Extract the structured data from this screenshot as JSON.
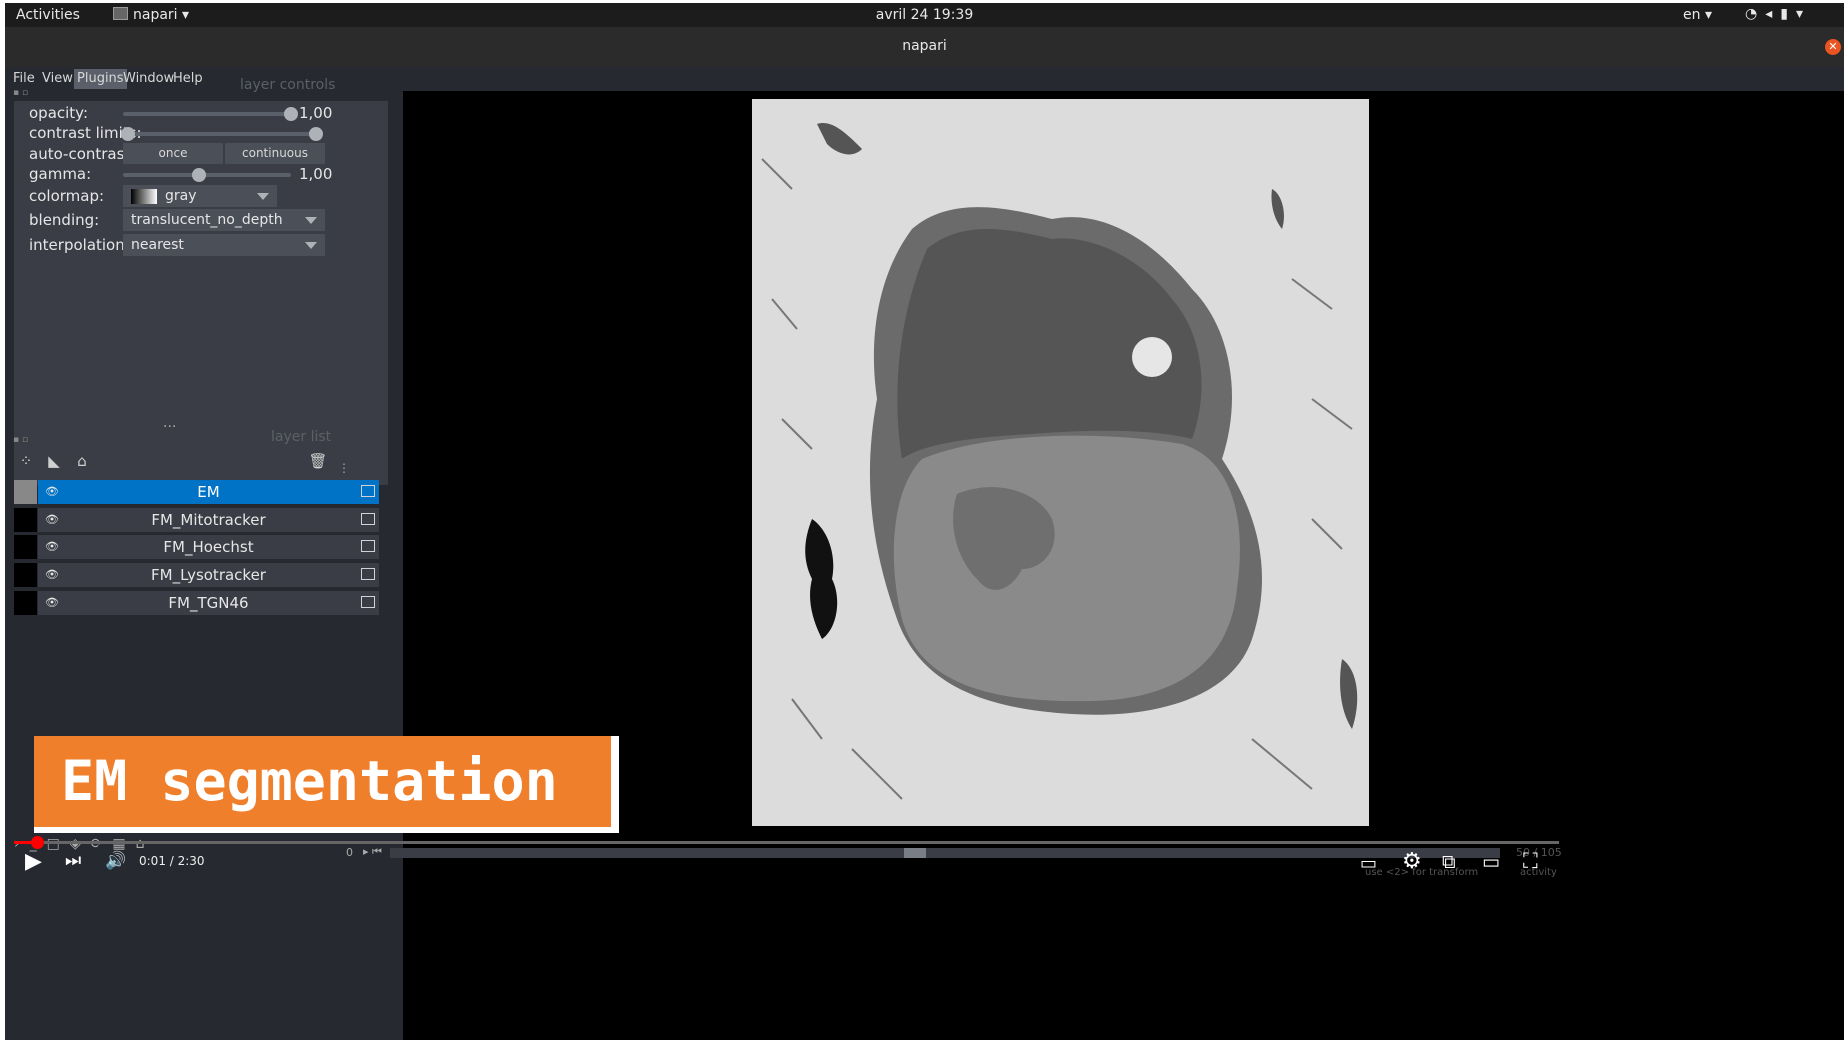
{
  "system_bar": {
    "activities": "Activities",
    "app_name": "napari",
    "clock": "avril 24  19:39",
    "language": "en"
  },
  "window": {
    "title": "napari"
  },
  "menu": [
    "File",
    "View",
    "Plugins",
    "Window",
    "Help"
  ],
  "layer_controls": {
    "title": "layer controls",
    "opacity_label": "opacity:",
    "opacity_value": "1,00",
    "opacity_fraction": 1.0,
    "contrast_label": "contrast limits:",
    "contrast_range": [
      0.0,
      1.0
    ],
    "autocontrast_label": "auto-contrast:",
    "once": "once",
    "continuous": "continuous",
    "gamma_label": "gamma:",
    "gamma_value": "1,00",
    "gamma_fraction": 0.45,
    "colormap_label": "colormap:",
    "colormap": "gray",
    "blending_label": "blending:",
    "blending": "translucent_no_depth",
    "interpolation_label": "interpolation:",
    "interpolation": "nearest"
  },
  "layer_list": {
    "title": "layer list",
    "layers": [
      "EM",
      "FM_Mitotracker",
      "FM_Hoechst",
      "FM_Lysotracker",
      "FM_TGN46"
    ],
    "selected": "EM"
  },
  "overlay": {
    "banner": "EM segmentation"
  },
  "player": {
    "time": "0:01 / 2:30",
    "progress_fraction": 0.007,
    "slider_start": "0",
    "slice": "50 / 105",
    "hint": "use <2> for transform",
    "activity": "activity"
  },
  "colors": {
    "accent": "#0073c7",
    "banner": "#f07f2b",
    "progress": "#ff0000",
    "panel": "#262930",
    "control": "#3a3d45"
  }
}
